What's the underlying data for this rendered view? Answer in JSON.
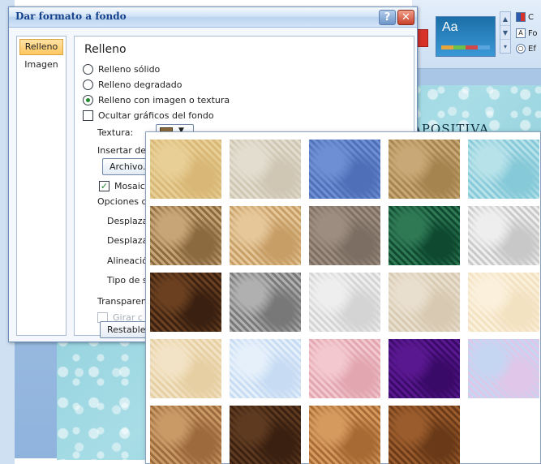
{
  "dialog": {
    "title": "Dar formato a fondo",
    "help_icon": "?",
    "close_icon": "✕",
    "nav": [
      {
        "label": "Relleno",
        "selected": true
      },
      {
        "label": "Imagen",
        "selected": false
      }
    ],
    "panel_title": "Relleno",
    "fill_options": [
      {
        "label": "Relleno sólido",
        "selected": false
      },
      {
        "label": "Relleno degradado",
        "selected": false
      },
      {
        "label": "Relleno con imagen o textura",
        "selected": true
      }
    ],
    "hide_graphics": {
      "label": "Ocultar gráficos del fondo",
      "checked": false
    },
    "texture_label": "Textura:",
    "insert_from_label": "Insertar de",
    "file_button": "Archivo.",
    "tile_checkbox": {
      "label": "Mosaico",
      "checked": true
    },
    "tile_options_label": "Opciones d",
    "offset_x_label": "Desplaza",
    "offset_y_label": "Desplaza",
    "alignment_label": "Alineació",
    "mirror_label": "Tipo de s",
    "transparency_label": "Transparen",
    "rotate_checkbox": {
      "label": "Girar c",
      "checked": false,
      "disabled": true
    },
    "reset_button": "Restable"
  },
  "background_app": {
    "slide_title_fragment": "APOSITIVA",
    "theme_thumb_label": "Aa",
    "ribbon_items": [
      "C",
      "Fo",
      "Ef"
    ],
    "ribbon_item_icons": [
      "colors-icon",
      "fonts-icon",
      "effects-icon"
    ]
  },
  "textures": [
    {
      "name": "papiro",
      "colors": [
        "#e8cf96",
        "#d9b877"
      ]
    },
    {
      "name": "lienzo",
      "colors": [
        "#e3ddd0",
        "#cfc6b3"
      ]
    },
    {
      "name": "tela-vaquera",
      "colors": [
        "#6f8fd4",
        "#4f6fb8"
      ]
    },
    {
      "name": "arpillera",
      "colors": [
        "#c9a877",
        "#a5844f"
      ]
    },
    {
      "name": "gotas-de-agua",
      "colors": [
        "#b8e2ea",
        "#86c9d8"
      ]
    },
    {
      "name": "papel-arrugado",
      "colors": [
        "#c8a577",
        "#8c6a40"
      ]
    },
    {
      "name": "fosil",
      "colors": [
        "#e5c79a",
        "#c79e66"
      ]
    },
    {
      "name": "arena",
      "colors": [
        "#9c8d80",
        "#7c6e62"
      ]
    },
    {
      "name": "marmol-verde",
      "colors": [
        "#2f7a55",
        "#0f4a30"
      ]
    },
    {
      "name": "marmol-blanco",
      "colors": [
        "#eeeeee",
        "#c8c8c8"
      ]
    },
    {
      "name": "marmol-marron",
      "colors": [
        "#6a4020",
        "#3a2010"
      ]
    },
    {
      "name": "granito",
      "colors": [
        "#b0b0b0",
        "#787878"
      ]
    },
    {
      "name": "papel-periodico",
      "colors": [
        "#eeeeee",
        "#d4d4d4"
      ]
    },
    {
      "name": "papel-reciclado",
      "colors": [
        "#e9dfce",
        "#d8cab2"
      ]
    },
    {
      "name": "pergamino",
      "colors": [
        "#fbf0dc",
        "#f3e2c1"
      ]
    },
    {
      "name": "papel-de-pergamino",
      "colors": [
        "#f3e3c6",
        "#e6cfa3"
      ]
    },
    {
      "name": "seda-azul",
      "colors": [
        "#e6f0fb",
        "#c7dcf3"
      ]
    },
    {
      "name": "papel-rosa",
      "colors": [
        "#f3c9cf",
        "#e2a6b0"
      ]
    },
    {
      "name": "tela-morada",
      "colors": [
        "#5a1890",
        "#3a0a68"
      ]
    },
    {
      "name": "ramo",
      "colors": [
        "#c5d6f3",
        "#e0c6e8"
      ]
    },
    {
      "name": "corcho",
      "colors": [
        "#c99966",
        "#9c6a3c"
      ]
    },
    {
      "name": "nogal",
      "colors": [
        "#5e3a20",
        "#3a2010"
      ]
    },
    {
      "name": "roble",
      "colors": [
        "#d59a5e",
        "#a86a34"
      ]
    },
    {
      "name": "madera-media",
      "colors": [
        "#9a5c2c",
        "#6a3a18"
      ]
    }
  ]
}
